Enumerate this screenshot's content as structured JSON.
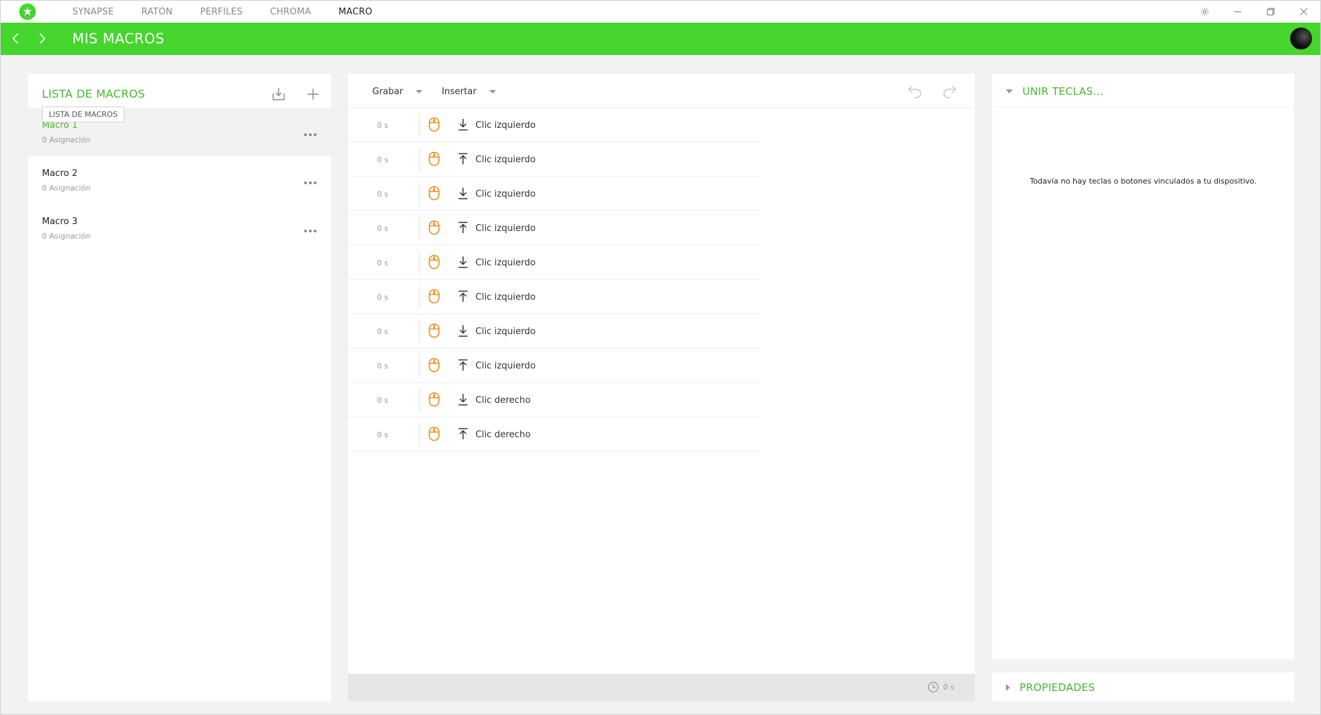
{
  "colors": {
    "accent": "#44d62c",
    "accent_text": "#44b82c",
    "mouse_icon": "#f08c1e"
  },
  "topnav": {
    "items": [
      {
        "label": "SYNAPSE",
        "active": false
      },
      {
        "label": "RATÓN",
        "active": false
      },
      {
        "label": "PERFILES",
        "active": false
      },
      {
        "label": "CHROMA",
        "active": false
      },
      {
        "label": "MACRO",
        "active": true
      }
    ]
  },
  "header": {
    "title": "MIS MACROS"
  },
  "macro_list": {
    "title": "LISTA DE MACROS",
    "tooltip": "LISTA DE MACROS",
    "items": [
      {
        "name": "Macro 1",
        "sub": "0 Asignación",
        "selected": true
      },
      {
        "name": "Macro 2",
        "sub": "0 Asignación",
        "selected": false
      },
      {
        "name": "Macro 3",
        "sub": "0 Asignación",
        "selected": false
      }
    ]
  },
  "editor": {
    "record_label": "Grabar",
    "insert_label": "Insertar",
    "rows": [
      {
        "time": "0 s",
        "dir": "down",
        "label": "Clic izquierdo"
      },
      {
        "time": "0 s",
        "dir": "up",
        "label": "Clic izquierdo"
      },
      {
        "time": "0 s",
        "dir": "down",
        "label": "Clic izquierdo"
      },
      {
        "time": "0 s",
        "dir": "up",
        "label": "Clic izquierdo"
      },
      {
        "time": "0 s",
        "dir": "down",
        "label": "Clic izquierdo"
      },
      {
        "time": "0 s",
        "dir": "up",
        "label": "Clic izquierdo"
      },
      {
        "time": "0 s",
        "dir": "down",
        "label": "Clic izquierdo"
      },
      {
        "time": "0 s",
        "dir": "up",
        "label": "Clic izquierdo"
      },
      {
        "time": "0 s",
        "dir": "down",
        "label": "Clic derecho"
      },
      {
        "time": "0 s",
        "dir": "up",
        "label": "Clic derecho"
      }
    ],
    "total_time": "0 s"
  },
  "bind_keys": {
    "title": "UNIR TECLAS...",
    "empty_message": "Todavía no hay teclas o botones vinculados a tu dispositivo."
  },
  "properties": {
    "title": "PROPIEDADES"
  }
}
